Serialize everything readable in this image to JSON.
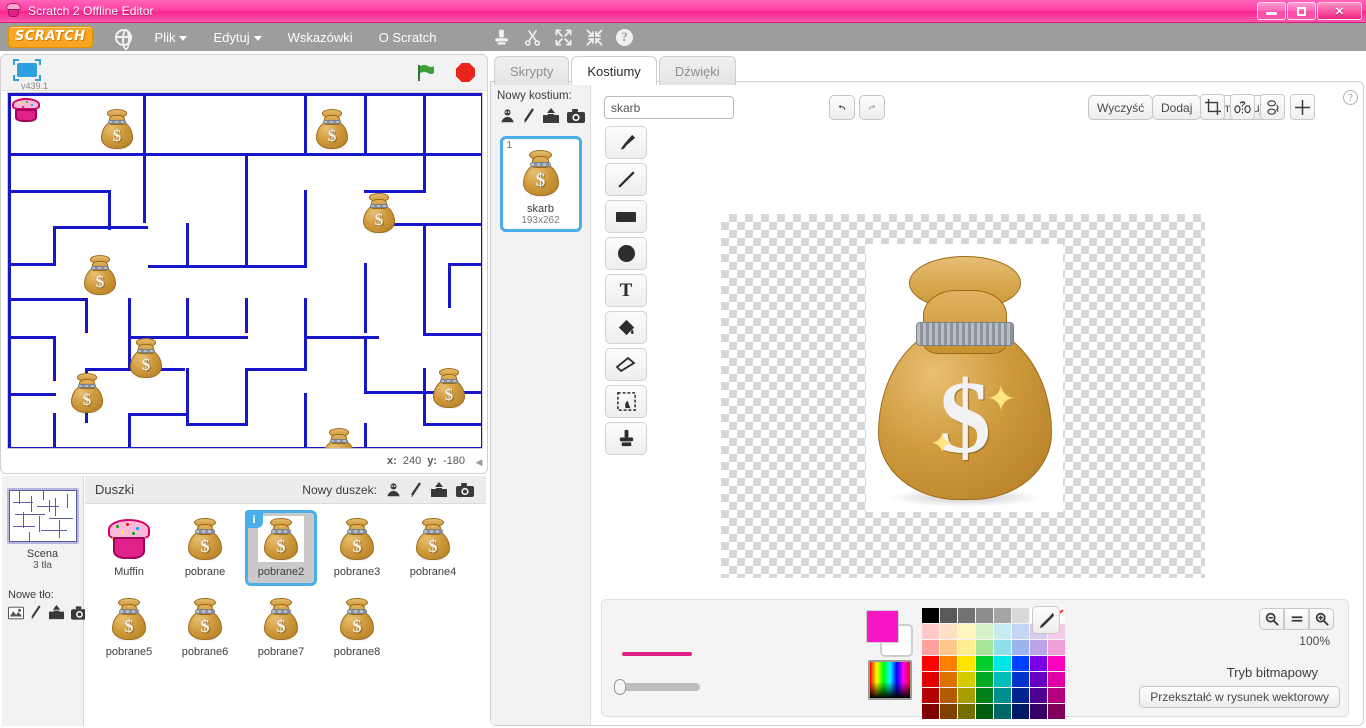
{
  "window": {
    "title": "Scratch 2 Offline Editor",
    "app_icon": "cupcake-icon",
    "controls": {
      "minimize": "minimize-button",
      "restore": "restore-button",
      "close": "close-button",
      "close_glyph": "✕"
    },
    "accent_color": "#ff3fa4"
  },
  "menubar": {
    "logo": "SCRATCH",
    "globe_icon": "globe-icon",
    "items": [
      {
        "label": "Plik",
        "has_caret": true
      },
      {
        "label": "Edytuj",
        "has_caret": true
      },
      {
        "label": "Wskazówki",
        "has_caret": false
      },
      {
        "label": "O Scratch",
        "has_caret": false
      }
    ],
    "tools": [
      {
        "name": "duplicate-icon"
      },
      {
        "name": "cut-scissors-icon"
      },
      {
        "name": "grow-icon"
      },
      {
        "name": "shrink-icon"
      },
      {
        "name": "help-icon",
        "glyph": "?"
      }
    ]
  },
  "stage": {
    "presentation_icon": "presentation-mode-icon",
    "version": "v439.1",
    "green_flag_icon": "green-flag-icon",
    "stop_icon": "stop-button-icon",
    "coord_x_label": "x:",
    "coord_x_value": "240",
    "coord_y_label": "y:",
    "coord_y_value": "-180",
    "resize_icon": "stage-resize-handle",
    "maze_color": "#1717c9",
    "background_color": "#ffffff"
  },
  "stage_selector": {
    "name": "Scena",
    "count": "3 tła",
    "new_backdrop_label": "Nowe tło:",
    "new_backdrop_icons": [
      {
        "name": "backdrop-library-icon"
      },
      {
        "name": "paint-backdrop-icon"
      },
      {
        "name": "upload-backdrop-icon"
      },
      {
        "name": "camera-backdrop-icon"
      }
    ]
  },
  "sprites": {
    "header_label": "Duszki",
    "new_sprite_label": "Nowy duszek:",
    "new_sprite_icons": [
      {
        "name": "sprite-library-icon"
      },
      {
        "name": "paint-sprite-icon"
      },
      {
        "name": "upload-sprite-icon"
      },
      {
        "name": "camera-sprite-icon"
      }
    ],
    "items": [
      {
        "label": "Muffin",
        "kind": "cupcake",
        "selected": false,
        "info": false
      },
      {
        "label": "pobrane",
        "kind": "moneybag",
        "selected": false,
        "info": false
      },
      {
        "label": "pobrane2",
        "kind": "moneybag",
        "selected": true,
        "info": true,
        "info_glyph": "i"
      },
      {
        "label": "pobrane3",
        "kind": "moneybag",
        "selected": false,
        "info": false
      },
      {
        "label": "pobrane4",
        "kind": "moneybag",
        "selected": false,
        "info": false
      },
      {
        "label": "pobrane5",
        "kind": "moneybag",
        "selected": false,
        "info": false
      },
      {
        "label": "pobrane6",
        "kind": "moneybag",
        "selected": false,
        "info": false
      },
      {
        "label": "pobrane7",
        "kind": "moneybag",
        "selected": false,
        "info": false
      },
      {
        "label": "pobrane8",
        "kind": "moneybag",
        "selected": false,
        "info": false
      }
    ]
  },
  "tabs": [
    {
      "label": "Skrypty",
      "active": false
    },
    {
      "label": "Kostiumy",
      "active": true
    },
    {
      "label": "Dźwięki",
      "active": false
    }
  ],
  "costumes": {
    "new_costume_label": "Nowy kostium:",
    "new_costume_icons": [
      {
        "name": "costume-library-icon"
      },
      {
        "name": "paint-costume-icon"
      },
      {
        "name": "upload-costume-icon"
      },
      {
        "name": "camera-costume-icon"
      }
    ],
    "items": [
      {
        "index": "1",
        "name": "skarb",
        "size": "193x262",
        "selected": true
      }
    ]
  },
  "paint": {
    "name_value": "skarb",
    "name_placeholder": "",
    "undo_icon": "undo-icon",
    "redo_icon": "redo-icon",
    "clear_label": "Wyczyść",
    "add_label": "Dodaj",
    "import_label": "Importuj",
    "transform_icons": [
      {
        "name": "crop-icon"
      },
      {
        "name": "flip-horizontal-icon"
      },
      {
        "name": "flip-vertical-icon"
      },
      {
        "name": "set-costume-center-icon"
      }
    ],
    "help_glyph": "?",
    "tools": [
      {
        "name": "brush-tool-icon"
      },
      {
        "name": "line-tool-icon"
      },
      {
        "name": "rectangle-tool-icon"
      },
      {
        "name": "ellipse-tool-icon"
      },
      {
        "name": "text-tool-icon",
        "glyph": "T"
      },
      {
        "name": "fill-tool-icon"
      },
      {
        "name": "eraser-tool-icon"
      },
      {
        "name": "select-tool-icon"
      },
      {
        "name": "stamp-tool-icon"
      }
    ],
    "brush_color": "#e0218a",
    "foreground_color": "#f716c4",
    "background_color": "#ffffff",
    "eyedropper_icon": "eyedropper-icon",
    "zoom_out_icon": "zoom-out-icon",
    "zoom_reset_icon": "zoom-reset-icon",
    "zoom_in_icon": "zoom-in-icon",
    "zoom_level": "100%",
    "mode_label": "Tryb bitmapowy",
    "convert_label": "Przekształć w rysunek wektorowy",
    "swatch_rows": [
      [
        "#000000",
        "#595959",
        "#737373",
        "#8c8c8c",
        "#a6a6a6",
        "#d9d9d9",
        "#ffffff",
        "#ff2b2b"
      ],
      [
        "#ffc9c9",
        "#ffe0c2",
        "#fff6bf",
        "#d4f0c8",
        "#c6eef2",
        "#c6d4f5",
        "#d8c9f0",
        "#f5c9e8"
      ],
      [
        "#ff9f9f",
        "#ffc78a",
        "#ffee8f",
        "#a8e49a",
        "#8fe0ea",
        "#9cb4ef",
        "#bda4e8",
        "#ef9fd8"
      ],
      [
        "#ff0000",
        "#ff8000",
        "#ffe500",
        "#00cc2a",
        "#00e5e5",
        "#0040ff",
        "#7a00e8",
        "#ff00bf"
      ],
      [
        "#e00000",
        "#e07000",
        "#d4cc00",
        "#00a824",
        "#00bcbc",
        "#0033cc",
        "#6600c2",
        "#e000a5"
      ],
      [
        "#b30000",
        "#b35900",
        "#a89e00",
        "#008018",
        "#008f8f",
        "#00248f",
        "#4d0091",
        "#b3007f"
      ],
      [
        "#800000",
        "#804000",
        "#756f00",
        "#005c11",
        "#006666",
        "#001966",
        "#370066",
        "#80005a"
      ]
    ]
  }
}
